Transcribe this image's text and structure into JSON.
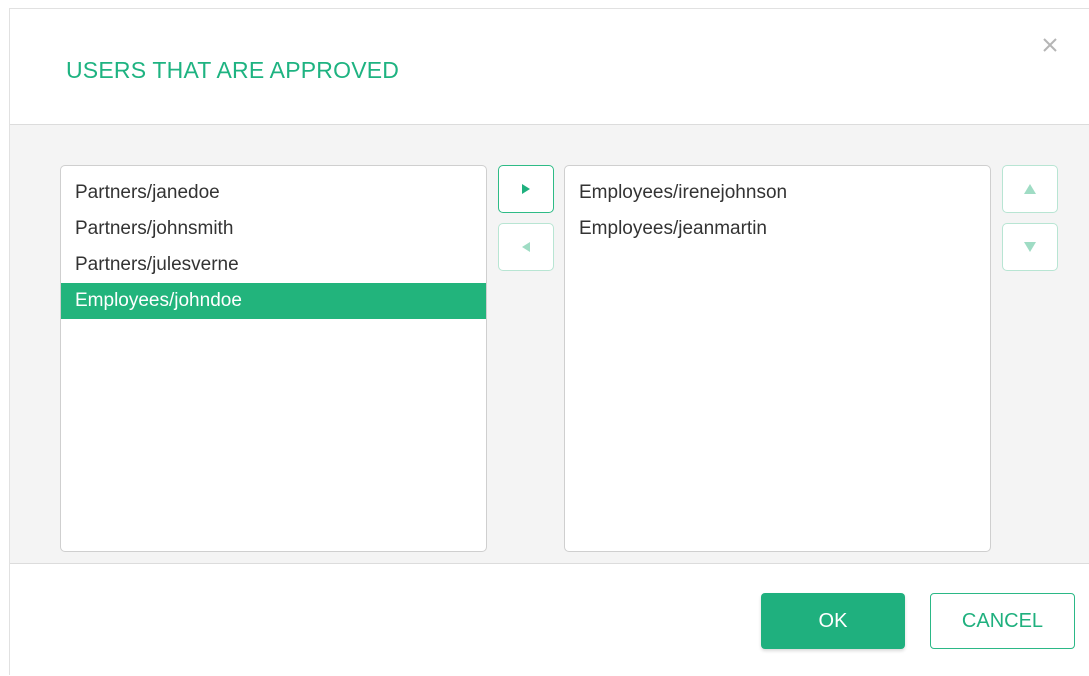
{
  "dialog": {
    "title": "USERS THAT ARE APPROVED",
    "close_icon": "close-icon"
  },
  "available_list": {
    "items": [
      {
        "label": "Partners/janedoe",
        "selected": false
      },
      {
        "label": "Partners/johnsmith",
        "selected": false
      },
      {
        "label": "Partners/julesverne",
        "selected": false
      },
      {
        "label": "Employees/johndoe",
        "selected": true
      }
    ]
  },
  "approved_list": {
    "items": [
      {
        "label": "Employees/irenejohnson",
        "selected": false
      },
      {
        "label": "Employees/jeanmartin",
        "selected": false
      }
    ]
  },
  "transfer_buttons": {
    "move_right_icon": "triangle-right-icon",
    "move_left_icon": "triangle-left-icon"
  },
  "order_buttons": {
    "move_up_icon": "triangle-up-icon",
    "move_down_icon": "triangle-down-icon"
  },
  "footer": {
    "ok_label": "OK",
    "cancel_label": "CANCEL"
  },
  "colors": {
    "accent": "#1fb07e",
    "selected_row": "#22b47c",
    "body_background": "#f4f4f4"
  }
}
